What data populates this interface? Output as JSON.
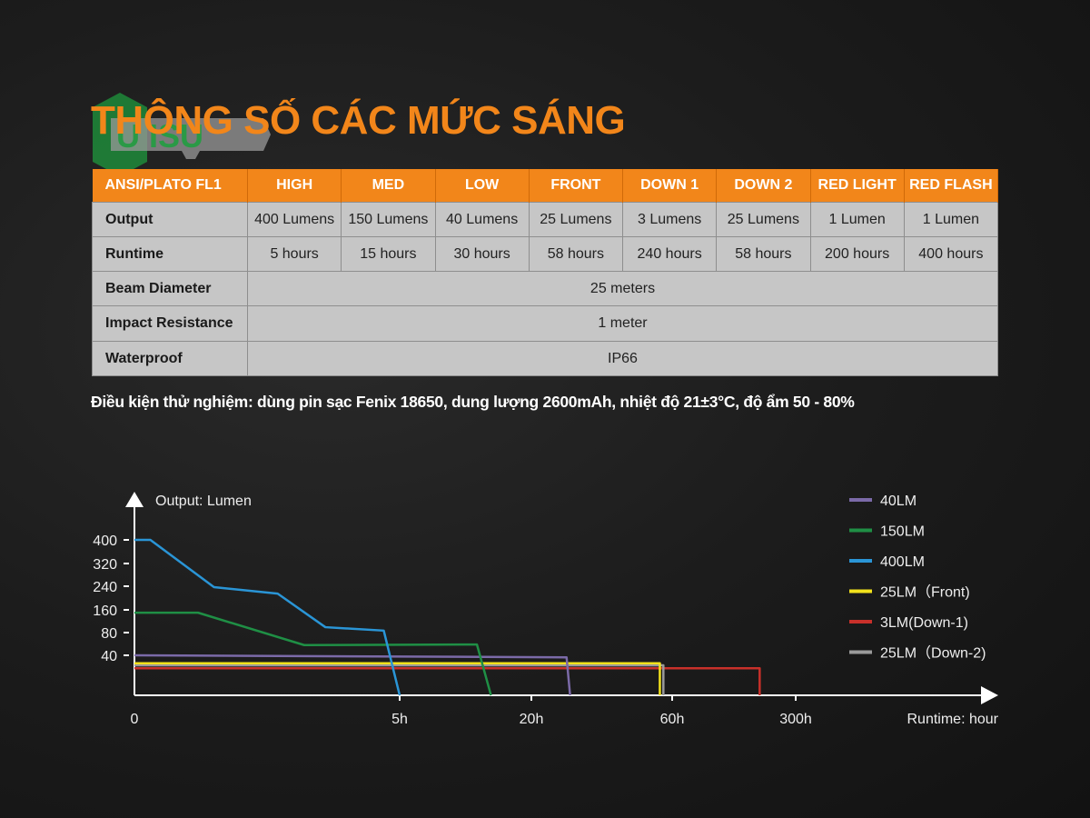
{
  "logo": {
    "text": "ISU",
    "colors": {
      "hex": "#1f8a3a",
      "plate": "#9a9a9a"
    }
  },
  "title": "THÔNG SỐ CÁC MỨC SÁNG",
  "table": {
    "header": [
      "ANSI/PLATO FL1",
      "HIGH",
      "MED",
      "LOW",
      "FRONT",
      "DOWN 1",
      "DOWN 2",
      "RED LIGHT",
      "RED FLASH"
    ],
    "output": {
      "label": "Output",
      "values": [
        "400 Lumens",
        "150 Lumens",
        "40 Lumens",
        "25 Lumens",
        "3 Lumens",
        "25 Lumens",
        "1 Lumen",
        "1 Lumen"
      ]
    },
    "runtime": {
      "label": "Runtime",
      "values": [
        "5 hours",
        "15 hours",
        "30 hours",
        "58 hours",
        "240 hours",
        "58 hours",
        "200 hours",
        "400 hours"
      ]
    },
    "beam": {
      "label": "Beam Diameter",
      "value": "25 meters"
    },
    "impact": {
      "label": "Impact Resistance",
      "value": "1 meter"
    },
    "waterproof": {
      "label": "Waterproof",
      "value": "IP66"
    },
    "colors": {
      "header_bg": "#f2861a",
      "cell_bg": "#c6c6c6"
    }
  },
  "note": "Điều kiện thử nghiệm: dùng pin sạc Fenix 18650, dung lượng 2600mAh, nhiệt độ 21±3°C, độ ẩm 50 - 80%",
  "chart_data": {
    "type": "line",
    "ylabel": "Output: Lumen",
    "xlabel": "Runtime: hour",
    "x_ticks": [
      {
        "value": 0,
        "label": "0"
      },
      {
        "value": 5,
        "label": "5h"
      },
      {
        "value": 20,
        "label": "20h"
      },
      {
        "value": 60,
        "label": "60h"
      },
      {
        "value": 300,
        "label": "300h"
      }
    ],
    "y_ticks": [
      40,
      80,
      160,
      240,
      320,
      400
    ],
    "x_scale": "non-linear (piecewise between ticks)",
    "y_scale": "non-linear (piecewise between ticks)",
    "grid": false,
    "legend_position": "right",
    "series": [
      {
        "name": "40LM",
        "color": "#7b6aa8",
        "points": [
          [
            0,
            40
          ],
          [
            30,
            38
          ],
          [
            31,
            0
          ]
        ]
      },
      {
        "name": "150LM",
        "color": "#1f8f45",
        "points": [
          [
            0,
            150
          ],
          [
            1.2,
            150
          ],
          [
            3.2,
            58
          ],
          [
            13.8,
            59
          ],
          [
            15.4,
            0
          ]
        ]
      },
      {
        "name": "400LM",
        "color": "#2a95d6",
        "points": [
          [
            0,
            400
          ],
          [
            0.3,
            400
          ],
          [
            1.5,
            237
          ],
          [
            2.7,
            215
          ],
          [
            3.6,
            99
          ],
          [
            4.7,
            87
          ],
          [
            5,
            0
          ]
        ]
      },
      {
        "name": "25LM（Front)",
        "color": "#f2e21c",
        "points": [
          [
            0,
            32
          ],
          [
            56.5,
            32
          ],
          [
            56.5,
            0
          ]
        ]
      },
      {
        "name": "3LM(Down-1)",
        "color": "#c8302a",
        "points": [
          [
            0,
            27
          ],
          [
            230,
            27
          ],
          [
            230,
            0
          ]
        ]
      },
      {
        "name": "25LM（Down-2)",
        "color": "#9a9a9a",
        "points": [
          [
            0,
            30
          ],
          [
            57.5,
            30
          ],
          [
            57.5,
            0
          ]
        ]
      }
    ]
  }
}
